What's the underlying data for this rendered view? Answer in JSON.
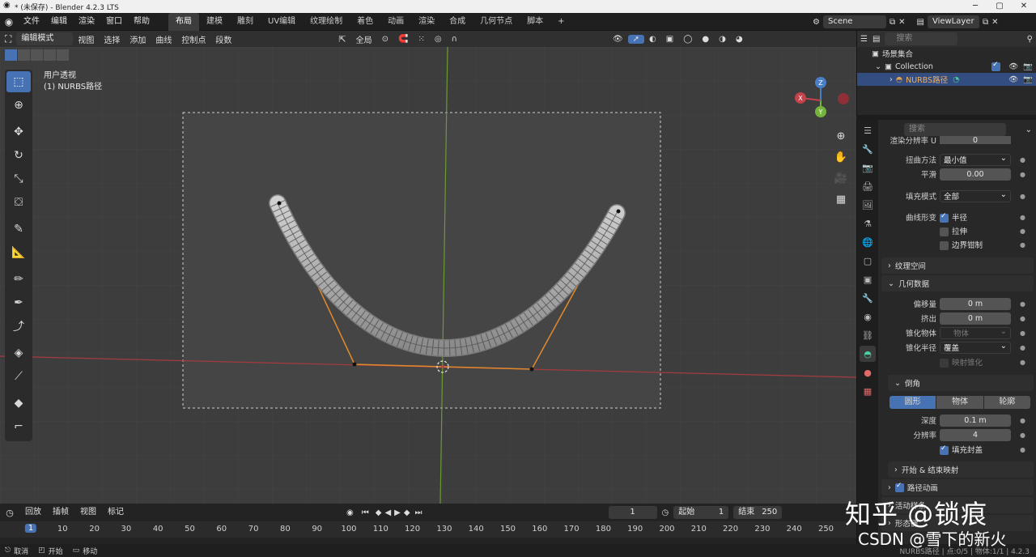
{
  "window": {
    "title": "* (未保存) - Blender 4.2.3 LTS"
  },
  "menus": [
    "文件",
    "编辑",
    "渲染",
    "窗口",
    "帮助"
  ],
  "workspaces": [
    "布局",
    "建模",
    "雕刻",
    "UV编辑",
    "纹理绘制",
    "着色",
    "动画",
    "渲染",
    "合成",
    "几何节点",
    "脚本"
  ],
  "active_workspace_index": 0,
  "scene": {
    "name": "Scene",
    "view_layer": "ViewLayer"
  },
  "viewport_header": {
    "mode": "编辑模式",
    "items": [
      "视图",
      "选择",
      "添加",
      "曲线",
      "控制点",
      "段数"
    ],
    "transform": "全局"
  },
  "viewport": {
    "view_name": "用户透视",
    "object_label": "(1) NURBS路径"
  },
  "gizmo": {
    "z": "Z",
    "y": "Y",
    "x": "X"
  },
  "outliner": {
    "search_placeholder": "搜索",
    "rows": [
      {
        "label": "场景集合"
      },
      {
        "label": "Collection"
      },
      {
        "label": "NURBS路径"
      }
    ]
  },
  "properties": {
    "search_placeholder": "搜索",
    "cut_row": "渲染分辨率 U",
    "cut_val": "0",
    "twist_method": {
      "label": "扭曲方法",
      "value": "最小值"
    },
    "smooth": {
      "label": "平滑",
      "value": "0.00"
    },
    "fill_mode": {
      "label": "填充模式",
      "value": "全部"
    },
    "curve_deform": {
      "label": "曲线形变",
      "radius": "半径",
      "stretch": "拉伸",
      "bounds_clamp": "边界钳制"
    },
    "texture_space": "纹理空间",
    "geometry": {
      "title": "几何数据",
      "offset": {
        "label": "偏移量",
        "value": "0 m"
      },
      "extrude": {
        "label": "挤出",
        "value": "0 m"
      },
      "taper_object": {
        "label": "锥化物体",
        "placeholder": "物体"
      },
      "taper_radius": {
        "label": "锥化半径",
        "value": "覆盖"
      },
      "map_taper": "映射锥化"
    },
    "bevel": {
      "title": "倒角",
      "tabs": [
        "圆形",
        "物体",
        "轮廓"
      ],
      "depth": {
        "label": "深度",
        "value": "0.1 m"
      },
      "resolution": {
        "label": "分辨率",
        "value": "4"
      },
      "fill_caps": "填充封盖"
    },
    "start_end_mapping": "开始 & 结束映射",
    "path_animation": "路径动画",
    "active_spline": "活动样条",
    "shape_keys": "形态键"
  },
  "timeline": {
    "menus": [
      "回放",
      "插帧",
      "视图",
      "标记"
    ],
    "current_frame": "1",
    "start_label": "起始",
    "start": "1",
    "end_label": "结束",
    "end": "250",
    "ruler": [
      "1",
      "10",
      "20",
      "30",
      "40",
      "50",
      "60",
      "70",
      "80",
      "90",
      "100",
      "110",
      "120",
      "130",
      "140",
      "150",
      "160",
      "170",
      "180",
      "190",
      "200",
      "210",
      "220",
      "230",
      "240",
      "250"
    ]
  },
  "statusbar": {
    "cancel": "取消",
    "start": "开始",
    "move": "移动",
    "right": "NURBS路径 | 点:0/5 | 物体:1/1 | 4.2.3"
  },
  "watermark": {
    "line1": "知乎 @锁痕",
    "line2": "CSDN @雪下的新火"
  },
  "colors": {
    "accent": "#4772b3",
    "curve_orange": "#e08a2e",
    "x_axis": "#c4424a",
    "y_axis": "#74b43d"
  }
}
